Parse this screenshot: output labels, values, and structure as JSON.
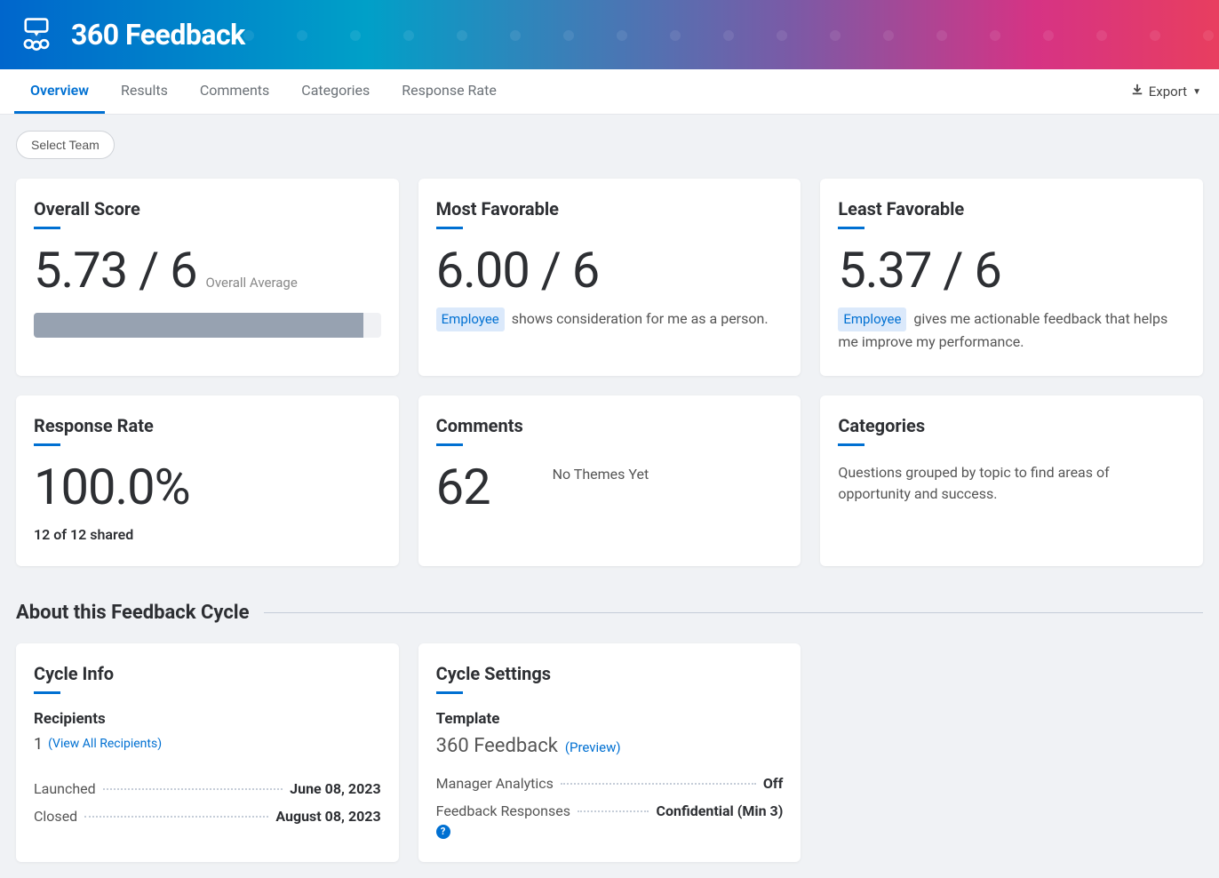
{
  "header": {
    "title": "360 Feedback"
  },
  "tabs": {
    "items": [
      {
        "label": "Overview",
        "active": true
      },
      {
        "label": "Results",
        "active": false
      },
      {
        "label": "Comments",
        "active": false
      },
      {
        "label": "Categories",
        "active": false
      },
      {
        "label": "Response Rate",
        "active": false
      }
    ],
    "export_label": "Export"
  },
  "select_team": "Select Team",
  "cards": {
    "overall_score": {
      "title": "Overall Score",
      "value": "5.73 / 6",
      "suffix": "Overall Average",
      "progress_pct": 95
    },
    "most_favorable": {
      "title": "Most Favorable",
      "value": "6.00 / 6",
      "tag": "Employee",
      "text": "shows consideration for me as a person."
    },
    "least_favorable": {
      "title": "Least Favorable",
      "value": "5.37 / 6",
      "tag": "Employee",
      "text": "gives me actionable feedback that helps me improve my performance."
    },
    "response_rate": {
      "title": "Response Rate",
      "value": "100.0%",
      "sub": "12 of 12 shared"
    },
    "comments": {
      "title": "Comments",
      "value": "62",
      "no_themes": "No Themes Yet"
    },
    "categories": {
      "title": "Categories",
      "text": "Questions grouped by topic to find areas of opportunity and success."
    }
  },
  "about": {
    "section_title": "About this Feedback Cycle",
    "cycle_info": {
      "title": "Cycle Info",
      "recipients_label": "Recipients",
      "recipients_count": "1",
      "view_all": "(View All Recipients)",
      "launched_label": "Launched",
      "launched_value": "June 08, 2023",
      "closed_label": "Closed",
      "closed_value": "August 08, 2023"
    },
    "cycle_settings": {
      "title": "Cycle Settings",
      "template_label": "Template",
      "template_name": "360 Feedback",
      "preview": "(Preview)",
      "manager_analytics_label": "Manager Analytics",
      "manager_analytics_value": "Off",
      "feedback_responses_label": "Feedback Responses",
      "feedback_responses_value": "Confidential (Min 3)"
    }
  }
}
